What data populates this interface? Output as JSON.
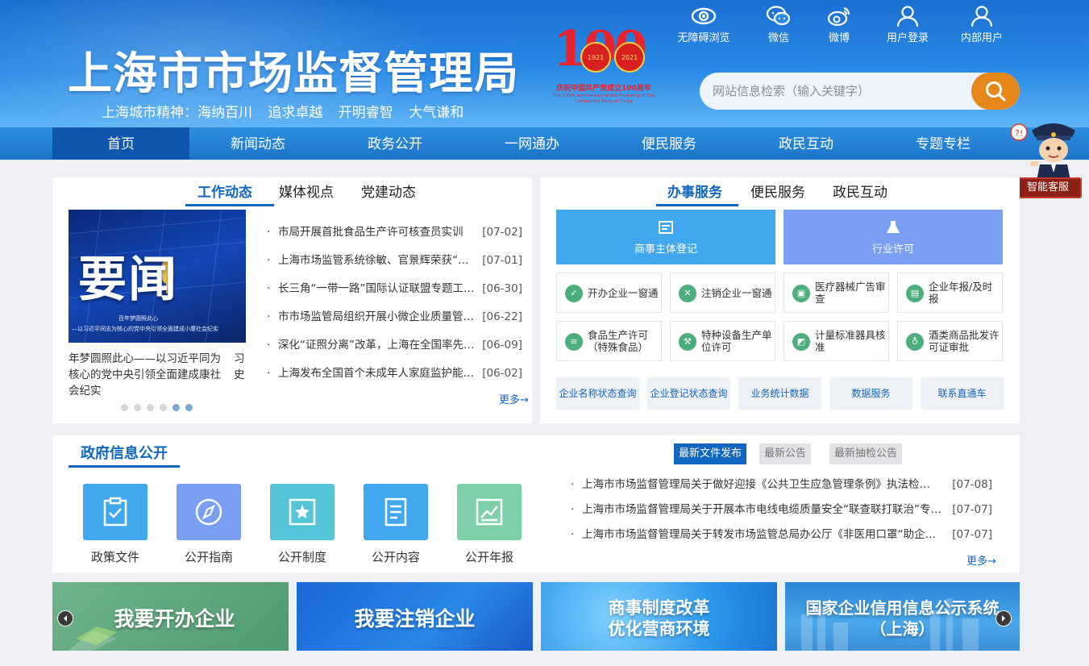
{
  "header": {
    "title": "上海市市场监督管理局",
    "motto": "上海城市精神：海纳百川 追求卓越 开明睿智 大气谦和",
    "anniversary": {
      "number": "100",
      "year_left": "1921",
      "year_right": "2021",
      "text": "庆祝中国共产党成立100周年",
      "english": "The 100th Anniversary of the Founding of The Communist Party of China"
    },
    "tools": [
      "无障碍浏览",
      "微信",
      "微博",
      "用户登录",
      "内部用户"
    ],
    "search": {
      "placeholder": "网站信息检索（输入关键字）"
    }
  },
  "nav": {
    "items": [
      "首页",
      "新闻动态",
      "政务公开",
      "一网通办",
      "便民服务",
      "政民互动",
      "专题专栏"
    ],
    "active_index": 0
  },
  "robot": {
    "label": "智能客服"
  },
  "news": {
    "tabs": [
      "工作动态",
      "媒体视点",
      "党建动态"
    ],
    "slide": {
      "big_text": "要闻",
      "caption_line1": "百年梦圆照此心",
      "caption_line2": "—以习近平同志为核心的党中央引领全面建成小康社会纪实",
      "caption": "年梦圆照此心——以习近平同为核心的党中央引领全面建成康社会纪实",
      "caption_next": "习史"
    },
    "dots_total": 6,
    "dots_active": [
      4,
      5
    ],
    "items": [
      {
        "title": "市局开展首批食品生产许可核查员实训",
        "date": "[07-02]"
      },
      {
        "title": "上海市场监管系统徐敏、官景辉荣获“…",
        "date": "[07-01]"
      },
      {
        "title": "长三角“一带一路”国际认证联盟专题工…",
        "date": "[06-30]"
      },
      {
        "title": "市市场监管局组织开展小微企业质量管…",
        "date": "[06-22]"
      },
      {
        "title": "深化“证照分离”改革，上海在全国率先…",
        "date": "[06-09]"
      },
      {
        "title": "上海发布全国首个未成年人家庭监护能…",
        "date": "[06-02]"
      }
    ],
    "more": "更多→"
  },
  "service": {
    "tabs": [
      "办事服务",
      "便民服务",
      "政民互动"
    ],
    "big": [
      {
        "label": "商事主体登记",
        "color": "#41a8f0"
      },
      {
        "label": "行业许可",
        "color": "#7a9ef2"
      }
    ],
    "cells": [
      {
        "label": "开办企业一窗通",
        "icon": "check-icon"
      },
      {
        "label": "注销企业一窗通",
        "icon": "cancel-icon"
      },
      {
        "label": "医疗器械广告审查",
        "icon": "medical-icon"
      },
      {
        "label": "企业年报/及时报",
        "icon": "report-icon"
      },
      {
        "label": "食品生产许可（特殊食品）",
        "icon": "food-icon"
      },
      {
        "label": "特种设备生产单位许可",
        "icon": "wrench-icon"
      },
      {
        "label": "计量标准器具核准",
        "icon": "measure-icon"
      },
      {
        "label": "酒类商品批发许可证审批",
        "icon": "wine-icon"
      }
    ],
    "links": [
      "企业名称状态查询",
      "企业登记状态查询",
      "业务统计数据",
      "数据服务",
      "联系直通车"
    ],
    "accent": "#4cae7a"
  },
  "gov": {
    "title": "政府信息公开",
    "icons": [
      {
        "label": "政策文件",
        "color": "#41a8f0"
      },
      {
        "label": "公开指南",
        "color": "#7a9ef2"
      },
      {
        "label": "公开制度",
        "color": "#55c5d8"
      },
      {
        "label": "公开内容",
        "color": "#41a8f0"
      },
      {
        "label": "公开年报",
        "color": "#7fcfa8"
      }
    ],
    "tabs": [
      "最新文件发布",
      "最新公告",
      "最新抽检公告"
    ],
    "items": [
      {
        "title": "上海市市场监督管理局关于做好迎接《公共卫生应急管理条例》执法检…",
        "date": "[07-08]"
      },
      {
        "title": "上海市市场监督管理局关于开展本市电线电缆质量安全“联查联打联治”专…",
        "date": "[07-07]"
      },
      {
        "title": "上海市市场监督管理局关于转发市场监管总局办公厅《非医用口罩“助企…",
        "date": "[07-07]"
      }
    ],
    "more": "更多→"
  },
  "banners": [
    {
      "line1": "我要开办企业",
      "line2": ""
    },
    {
      "line1": "我要注销企业",
      "line2": ""
    },
    {
      "line1": "商事制度改革",
      "line2": "优化营商环境"
    },
    {
      "line1": "国家企业信用信息公示系统",
      "line2": "（上海）"
    }
  ],
  "colors": {
    "primary": "#1166c0",
    "header": "#1b6fd0",
    "search_button": "#e6871a",
    "nav_active": "#0f57ad"
  }
}
